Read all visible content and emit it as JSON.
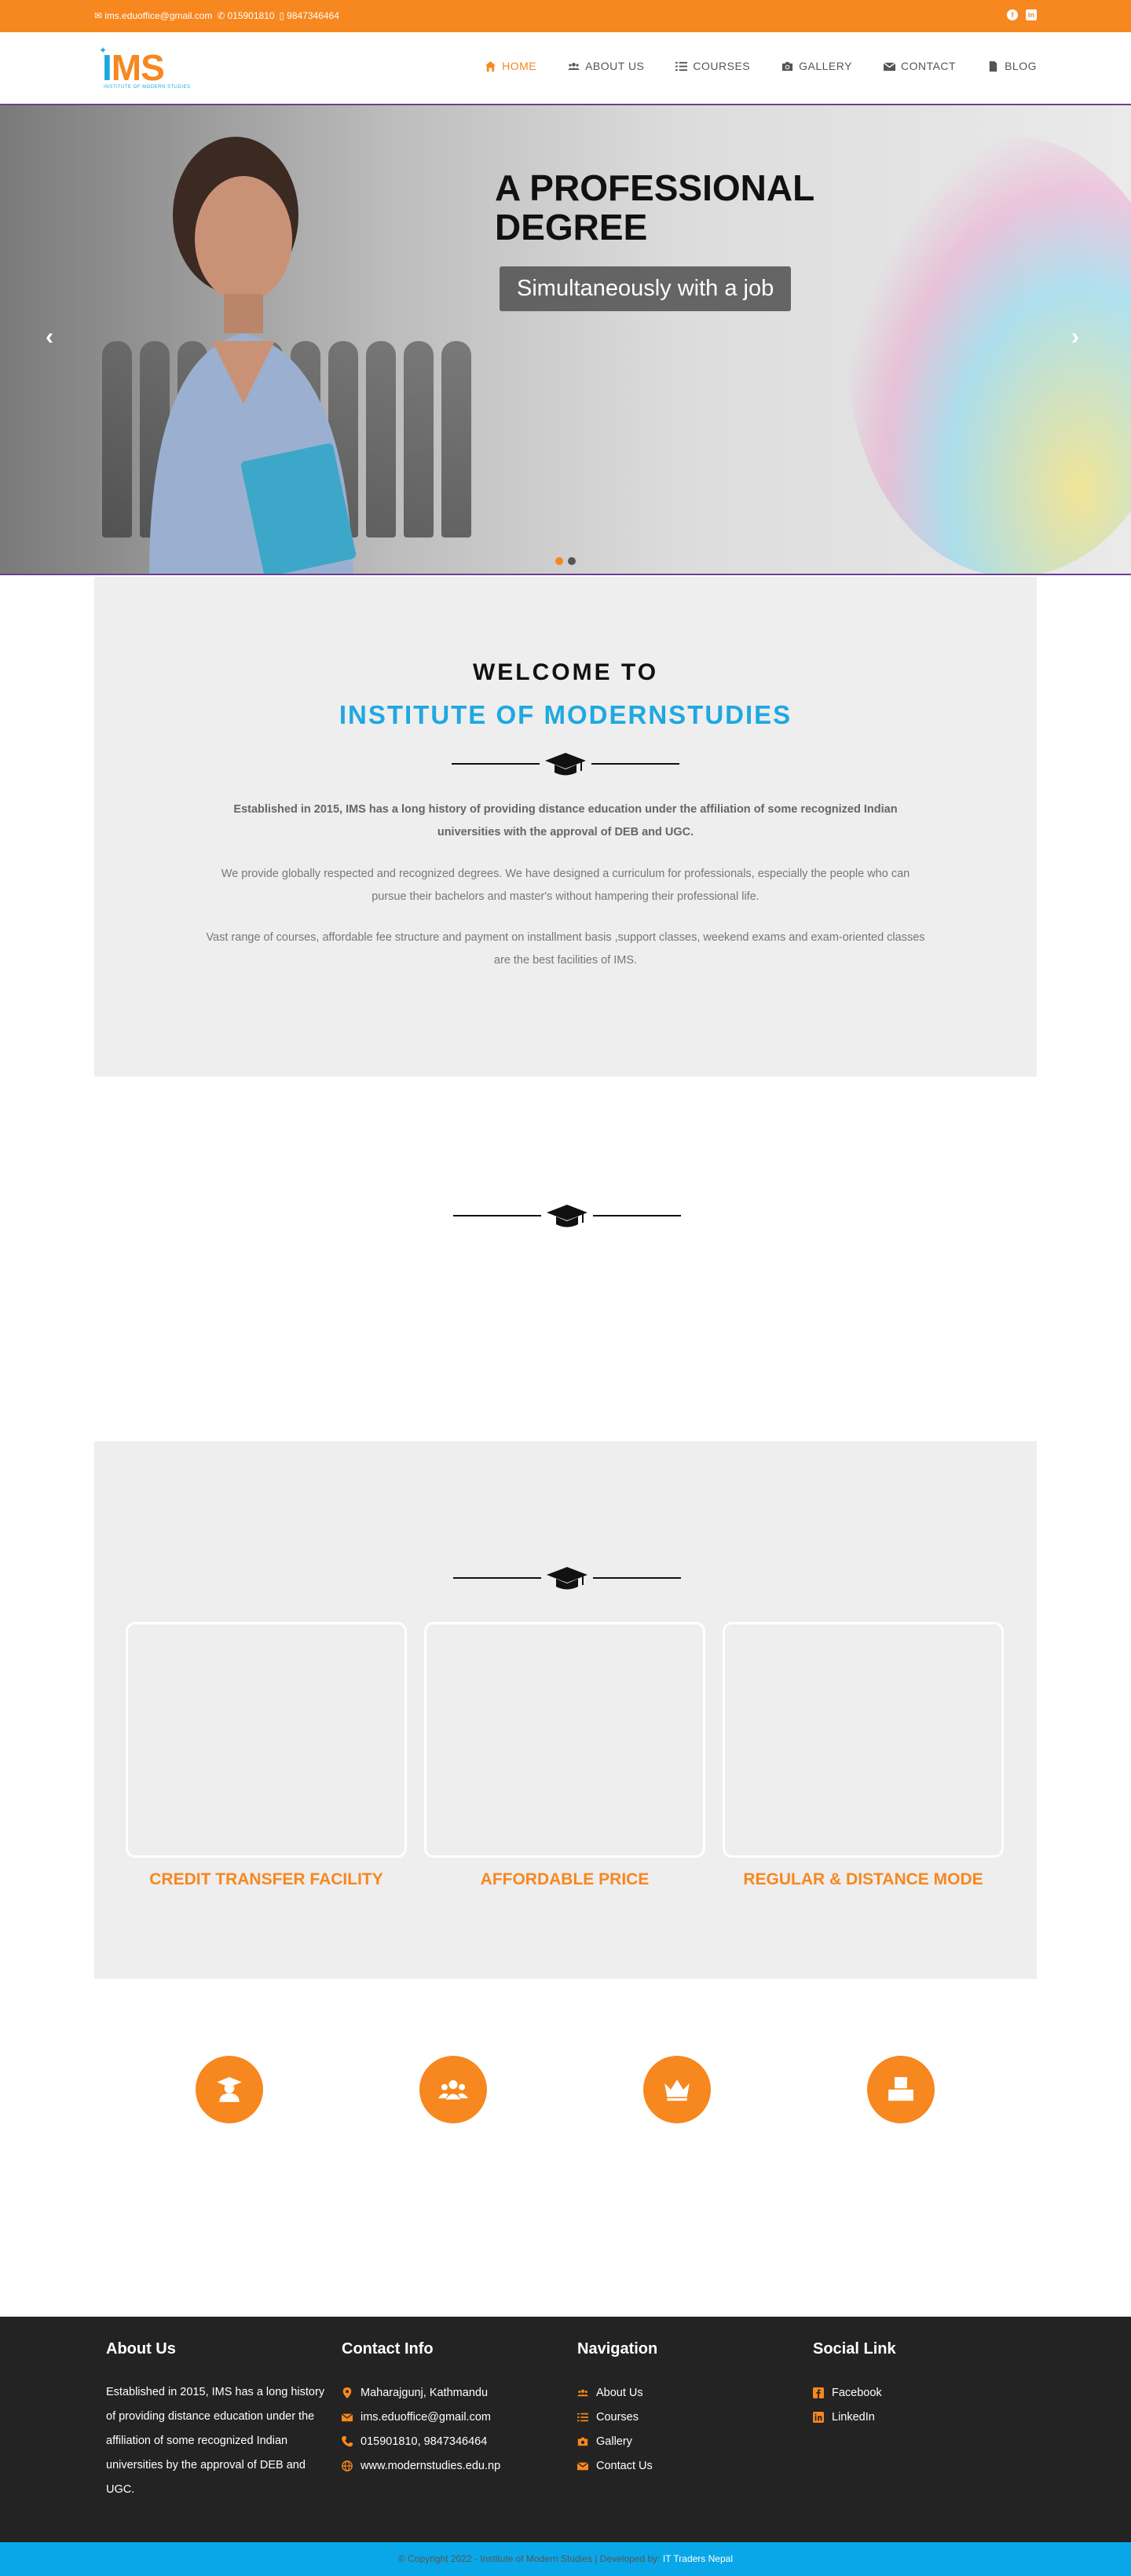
{
  "topbar": {
    "email": "ims.eduoffice@gmail.com",
    "phone": "015901810",
    "mobile": "9847346464",
    "social": [
      "facebook-icon",
      "linkedin-icon"
    ]
  },
  "logo": {
    "letters": "IMS",
    "tagline": "INSTITUTE OF MODERN STUDIES"
  },
  "nav": {
    "items": [
      {
        "label": "HOME",
        "icon": "home-icon"
      },
      {
        "label": "ABOUT US",
        "icon": "users-icon"
      },
      {
        "label": "COURSES",
        "icon": "list-icon"
      },
      {
        "label": "GALLERY",
        "icon": "camera-icon"
      },
      {
        "label": "CONTACT",
        "icon": "envelope-icon"
      },
      {
        "label": "BLOG",
        "icon": "file-icon"
      }
    ],
    "active": "HOME"
  },
  "hero": {
    "headline": "A PROFESSIONAL DEGREE",
    "subline": "Simultaneously with a job",
    "prev": "‹",
    "next": "›",
    "slides": 2,
    "active_slide": 1
  },
  "welcome": {
    "line1": "WELCOME TO",
    "line2": "INSTITUTE OF MODERNSTUDIES",
    "para1": "Established in 2015, IMS has a long history of providing distance education under the affiliation of some recognized Indian universities with the approval of DEB and  UGC.",
    "para2": "We provide globally respected and recognized degrees. We have designed a curriculum for professionals, especially the people who can pursue their bachelors and master's without hampering their professional life.",
    "para3": "Vast range of courses, affordable fee structure and payment on installment basis ,support classes, weekend exams and exam-oriented classes are the best facilities of IMS."
  },
  "features": {
    "items": [
      {
        "title": "CREDIT TRANSFER FACILITY"
      },
      {
        "title": "AFFORDABLE PRICE"
      },
      {
        "title": "REGULAR & DISTANCE MODE"
      }
    ]
  },
  "stats_icons": [
    "graduate-icon",
    "group-icon",
    "crown-icon",
    "boxes-icon"
  ],
  "footer": {
    "about": {
      "title": "About Us",
      "text": "Established in 2015, IMS has a long history of providing distance education under the affiliation of some recognized Indian universities by the approval of DEB and UGC."
    },
    "contact": {
      "title": "Contact Info",
      "address": "Maharajgunj, Kathmandu",
      "email": "ims.eduoffice@gmail.com",
      "phone": "015901810, 9847346464",
      "web": "www.modernstudies.edu.np"
    },
    "navigation": {
      "title": "Navigation",
      "items": [
        "About Us",
        "Courses",
        "Gallery",
        "Contact Us"
      ]
    },
    "social": {
      "title": "Social Link",
      "items": [
        "Facebook",
        "LinkedIn"
      ]
    }
  },
  "copyright": {
    "text": "© Copyright 2022 - Institute of Modern Studies | Developed by:",
    "developer": "IT Traders Nepal"
  },
  "colors": {
    "accent": "#f7871f",
    "brand_blue": "#1ea8e0",
    "footer_bg": "#232323",
    "copyright_bg": "#0aa7e8"
  }
}
